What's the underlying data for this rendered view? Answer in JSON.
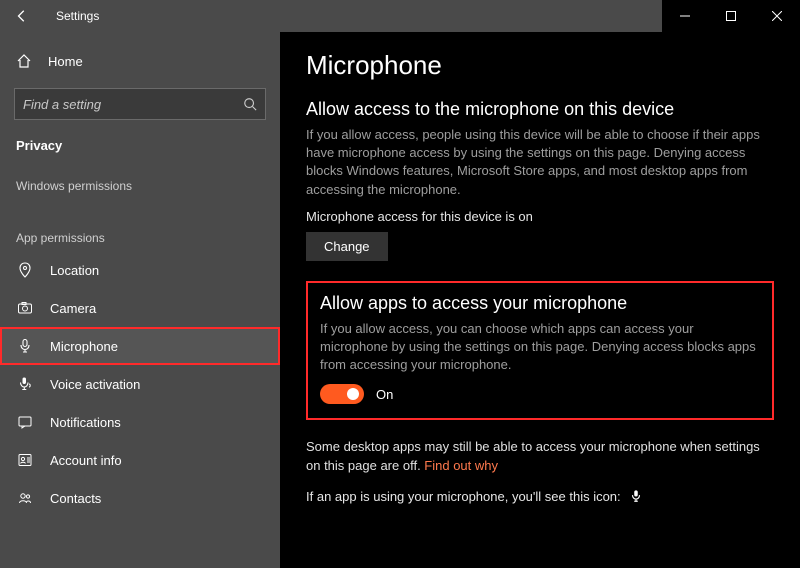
{
  "titlebar": {
    "title": "Settings"
  },
  "sidebar": {
    "home": "Home",
    "search_placeholder": "Find a setting",
    "privacy": "Privacy",
    "windows_perm_hdr": "Windows permissions",
    "app_perm_hdr": "App permissions",
    "items": [
      {
        "label": "Location"
      },
      {
        "label": "Camera"
      },
      {
        "label": "Microphone"
      },
      {
        "label": "Voice activation"
      },
      {
        "label": "Notifications"
      },
      {
        "label": "Account info"
      },
      {
        "label": "Contacts"
      }
    ]
  },
  "content": {
    "page_title": "Microphone",
    "section1_title": "Allow access to the microphone on this device",
    "section1_body": "If you allow access, people using this device will be able to choose if their apps have microphone access by using the settings on this page. Denying access blocks Windows features, Microsoft Store apps, and most desktop apps from accessing the microphone.",
    "device_status": "Microphone access for this device is on",
    "change_btn": "Change",
    "section2_title": "Allow apps to access your microphone",
    "section2_body": "If you allow access, you can choose which apps can access your microphone by using the settings on this page. Denying access blocks apps from accessing your microphone.",
    "toggle_state": "On",
    "desktop_note": "Some desktop apps may still be able to access your microphone when settings on this page are off. ",
    "find_out": "Find out why",
    "icon_note": "If an app is using your microphone, you'll see this icon:"
  }
}
